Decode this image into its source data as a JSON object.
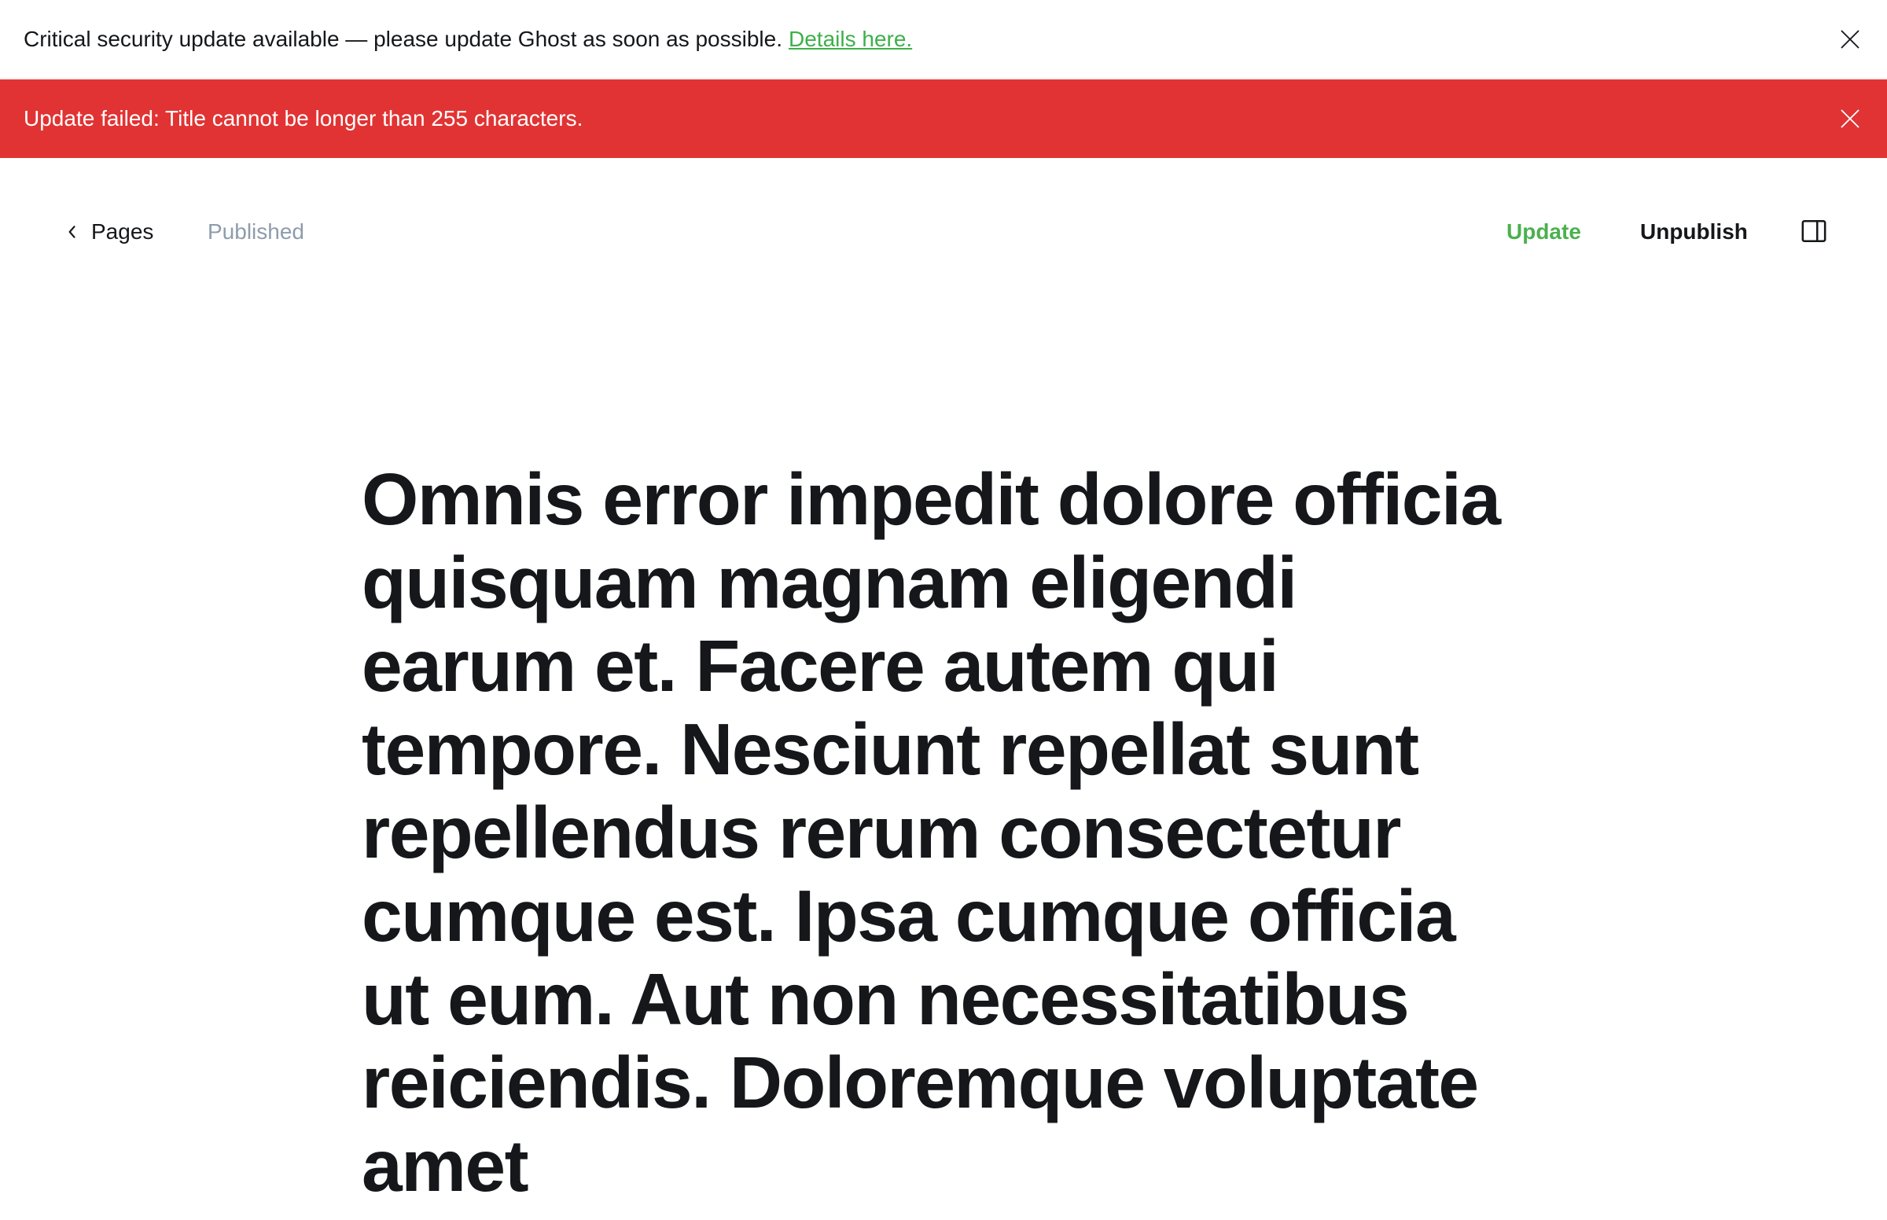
{
  "security_banner": {
    "message": "Critical security update available — please update Ghost as soon as possible.",
    "link_text": "Details here."
  },
  "error_alert": {
    "message": "Update failed: Title cannot be longer than 255 characters."
  },
  "editor_header": {
    "back_label": "Pages",
    "status": "Published",
    "update_label": "Update",
    "unpublish_label": "Unpublish"
  },
  "post": {
    "title": "Omnis error impedit dolore officia quisquam magnam eligendi earum et. Facere autem qui tempore. Nesciunt repellat sunt repellendus rerum consectetur cumque est. Ipsa cumque officia ut eum. Aut non necessitatibus reiciendis. Doloremque voluptate amet"
  },
  "colors": {
    "error": "#e13333",
    "accent": "#4cb04f",
    "muted": "#8e9cac",
    "text": "#15171a"
  }
}
